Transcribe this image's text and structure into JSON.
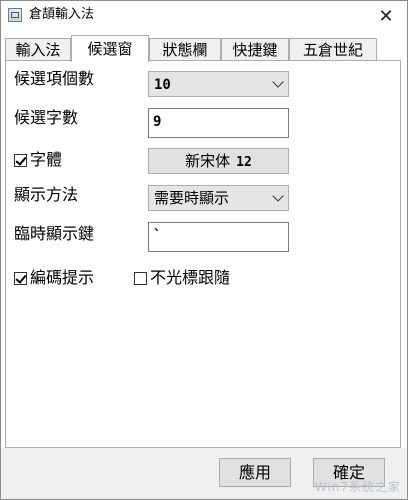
{
  "window": {
    "title": "倉頡輸入法",
    "close_glyph": "✕"
  },
  "tabs": [
    {
      "label": "輸入法",
      "active": false
    },
    {
      "label": "候選窗",
      "active": true
    },
    {
      "label": "狀態欄",
      "active": false
    },
    {
      "label": "快捷鍵",
      "active": false
    },
    {
      "label": "五倉世紀",
      "active": false
    }
  ],
  "candidate": {
    "count_label": "候選項個數",
    "count_value": "10",
    "chars_label": "候選字數",
    "chars_value": "9",
    "font_label": "字體",
    "font_checked": true,
    "font_name": "新宋体",
    "font_size": "12",
    "display_label": "顯示方法",
    "display_value": "需要時顯示",
    "temp_key_label": "臨時顯示鍵",
    "temp_key_value": "`",
    "code_hint_label": "編碼提示",
    "code_hint_checked": true,
    "cursor_follow_label": "不光標跟隨",
    "cursor_follow_checked": false
  },
  "footer": {
    "apply_label": "應用",
    "ok_label": "確定"
  },
  "watermark": "Win7系统之家"
}
